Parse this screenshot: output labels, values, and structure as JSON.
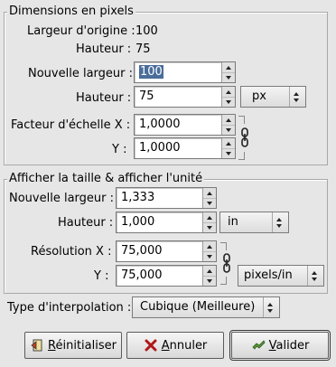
{
  "pixel_dims": {
    "legend": "Dimensions en pixels",
    "orig_width_label": "Largeur d'origine :",
    "orig_width_value": "100",
    "orig_height_label": "Hauteur :",
    "orig_height_value": "75",
    "new_width_label": "Nouvelle largeur :",
    "new_width_value": "100",
    "height_label": "Hauteur :",
    "height_value": "75",
    "unit": "px",
    "scale_x_label": "Facteur d'échelle X :",
    "scale_x_value": "1,0000",
    "scale_y_label": "Y :",
    "scale_y_value": "1,0000"
  },
  "print_size": {
    "legend": "Afficher la taille & afficher l'unité",
    "new_width_label": "Nouvelle largeur :",
    "new_width_value": "1,333",
    "height_label": "Hauteur :",
    "height_value": "1,000",
    "unit": "in",
    "res_x_label": "Résolution X :",
    "res_x_value": "75,000",
    "res_y_label": "Y :",
    "res_y_value": "75,000",
    "res_unit": "pixels/in"
  },
  "interpolation": {
    "label": "Type d'interpolation :",
    "value": "Cubique (Meilleure)"
  },
  "buttons": {
    "reset_prefix": "R",
    "reset_rest": "éinitialiser",
    "cancel_prefix": "A",
    "cancel_rest": "nnuler",
    "ok_prefix": "V",
    "ok_rest": "alider"
  }
}
